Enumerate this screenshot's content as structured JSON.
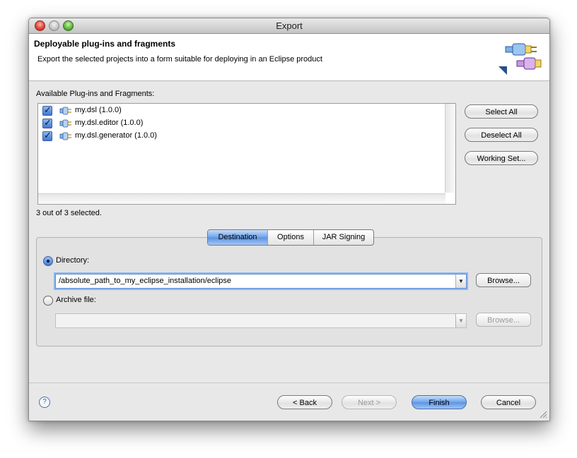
{
  "window": {
    "title": "Export"
  },
  "header": {
    "title": "Deployable plug-ins and fragments",
    "description": "Export the selected projects into a form suitable for deploying in an Eclipse product",
    "icon": "export-plugin-wizard-icon"
  },
  "plugins": {
    "label": "Available Plug-ins and Fragments:",
    "items": [
      {
        "name": "my.dsl (1.0.0)",
        "checked": true
      },
      {
        "name": "my.dsl.editor (1.0.0)",
        "checked": true
      },
      {
        "name": "my.dsl.generator (1.0.0)",
        "checked": true
      }
    ],
    "status": "3 out of 3 selected."
  },
  "side_buttons": {
    "select_all": "Select All",
    "deselect_all": "Deselect All",
    "working_set": "Working Set..."
  },
  "tabs": [
    {
      "label": "Destination",
      "active": true
    },
    {
      "label": "Options",
      "active": false
    },
    {
      "label": "JAR Signing",
      "active": false
    }
  ],
  "destination": {
    "directory_label": "Directory:",
    "directory_value": "/absolute_path_to_my_eclipse_installation/eclipse",
    "archive_label": "Archive file:",
    "archive_value": "",
    "browse_label": "Browse...",
    "selected": "directory"
  },
  "footer": {
    "help": "?",
    "back": "< Back",
    "next": "Next >",
    "finish": "Finish",
    "cancel": "Cancel"
  },
  "colors": {
    "accent": "#5d93e3",
    "window_bg": "#e8e8e8"
  }
}
